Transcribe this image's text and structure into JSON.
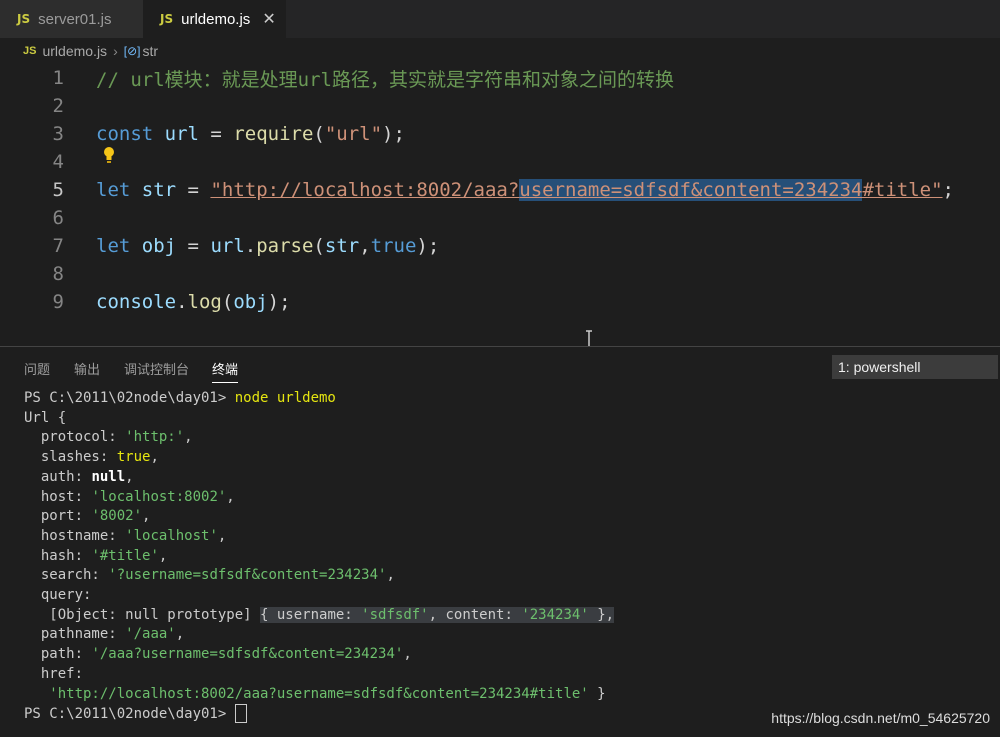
{
  "tabs": [
    {
      "icon": "JS",
      "label": "server01.js"
    },
    {
      "icon": "JS",
      "label": "urldemo.js",
      "close": "✕"
    }
  ],
  "breadcrumb": {
    "file": "urldemo.js",
    "symbol": "str",
    "symbol_icon": "[⊘]"
  },
  "editor": {
    "lines": [
      {
        "n": "1",
        "comment": "// url模块：就是处理url路径，其实就是字符串和对象之间的转换"
      },
      {
        "n": "2"
      },
      {
        "n": "3",
        "kw": "const",
        "var": "url",
        "eq": " = ",
        "fn": "require",
        "open": "(",
        "str": "\"url\"",
        "close": ");"
      },
      {
        "n": "4"
      },
      {
        "n": "5",
        "kw": "let",
        "var": "str",
        "eq": " = ",
        "str_a": "\"http://localhost:8002/aaa?",
        "str_sel": "username=sdfsdf&content=234234",
        "str_b": "#title\"",
        "end": ";"
      },
      {
        "n": "6"
      },
      {
        "n": "7",
        "kw": "let",
        "var": "obj",
        "eq": " = ",
        "obj": "url",
        "dot": ".",
        "fn": "parse",
        "open": "(",
        "arg1": "str",
        "comma": ",",
        "arg2": "true",
        "close": ");"
      },
      {
        "n": "8"
      },
      {
        "n": "9",
        "obj": "console",
        "dot": ".",
        "fn": "log",
        "open": "(",
        "arg1": "obj",
        "close": ");"
      }
    ]
  },
  "panel": {
    "tabs": [
      "问题",
      "输出",
      "调试控制台",
      "终端"
    ],
    "shell_selector": "1: powershell"
  },
  "terminal": {
    "prompt": "PS C:\\2011\\02node\\day01> ",
    "command": "node urldemo",
    "class_name": "Url {",
    "protocol": {
      "key": "  protocol: ",
      "val": "'http:'",
      "end": ","
    },
    "slashes": {
      "key": "  slashes: ",
      "val": "true",
      "end": ","
    },
    "auth": {
      "key": "  auth: ",
      "val": "null",
      "end": ","
    },
    "host": {
      "key": "  host: ",
      "val": "'localhost:8002'",
      "end": ","
    },
    "port": {
      "key": "  port: ",
      "val": "'8002'",
      "end": ","
    },
    "hostname": {
      "key": "  hostname: ",
      "val": "'localhost'",
      "end": ","
    },
    "hash": {
      "key": "  hash: ",
      "val": "'#title'",
      "end": ","
    },
    "search": {
      "key": "  search: ",
      "val": "'?username=sdfsdf&content=234234'",
      "end": ","
    },
    "query_key": "  query:",
    "query_prefix": "   [Object: null prototype] ",
    "query_open": "{ username: ",
    "query_user": "'sdfsdf'",
    "query_mid": ", content: ",
    "query_content": "'234234'",
    "query_close": " },",
    "pathname": {
      "key": "  pathname: ",
      "val": "'/aaa'",
      "end": ","
    },
    "path": {
      "key": "  path: ",
      "val": "'/aaa?username=sdfsdf&content=234234'",
      "end": ","
    },
    "href_key": "  href:",
    "href_val": "   'http://localhost:8002/aaa?username=sdfsdf&content=234234#title'",
    "href_end": " }",
    "prompt2": "PS C:\\2011\\02node\\day01> "
  },
  "watermark": "https://blog.csdn.net/m0_54625720",
  "colors": {
    "keyword": "#569cd6",
    "string": "#ce9178",
    "function": "#dcdcaa",
    "comment": "#6a9955",
    "selection": "#264f78",
    "terminal_string": "#6dbf6d"
  }
}
